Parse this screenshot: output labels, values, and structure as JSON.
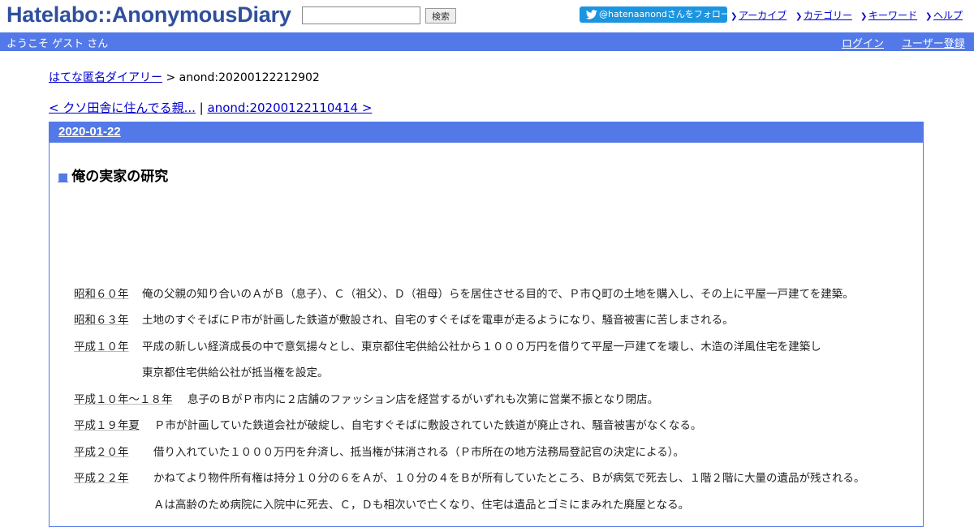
{
  "header": {
    "logo": "Hatelabo::AnonymousDiary",
    "search_value": "",
    "search_button": "検索",
    "twitter_follow": "@hatenaanondさんをフォロー",
    "links": [
      "アーカイブ",
      "カテゴリー",
      "キーワード",
      "ヘルプ"
    ]
  },
  "bluebar": {
    "welcome": "ようこそ ゲスト さん",
    "login": "ログイン",
    "register": "ユーザー登録"
  },
  "breadcrumb": {
    "home": "はてな匿名ダイアリー",
    "separator": " > ",
    "current": "anond:20200122212902"
  },
  "entry_nav": {
    "prev": "< クソ田舎に住んでる親...",
    "separator": " | ",
    "next": "anond:20200122110414 >"
  },
  "day": {
    "date": "2020-01-22",
    "title_marker": "■",
    "title": "俺の実家の研究"
  },
  "body_lines": [
    {
      "year": "昭和６０年",
      "text": "俺の父親の知り合いのＡがＢ（息子）、Ｃ（祖父）、Ｄ（祖母）らを居住させる目的で、Ｐ市Ｑ町の土地を購入し、その上に平屋一戸建てを建築。"
    },
    {
      "year": "昭和６３年",
      "text": "土地のすぐそばにＰ市が計画した鉄道が敷設され、自宅のすぐそばを電車が走るようになり、騒音被害に苦しまされる。"
    },
    {
      "year": "平成１０年",
      "text": "平成の新しい経済成長の中で意気揚々とし、東京都住宅供給公社から１０００万円を借りて平屋一戸建てを壊し、木造の洋風住宅を建築し"
    },
    {
      "year": "",
      "text": "東京都住宅供給公社が抵当権を設定。"
    },
    {
      "year": "平成１０年～１８年",
      "text": "息子のＢがＰ市内に２店舗のファッション店を経営するがいずれも次第に営業不振となり閉店。"
    },
    {
      "year": "平成１９年夏",
      "text": "Ｐ市が計画していた鉄道会社が破綻し、自宅すぐそばに敷設されていた鉄道が廃止され、騒音被害がなくなる。"
    },
    {
      "year": "平成２０年",
      "text": "借り入れていた１０００万円を弁済し、抵当権が抹消される（Ｐ市所在の地方法務局登記官の決定による）。"
    },
    {
      "year": "平成２２年",
      "text": "かねてより物件所有権は持分１０分の６をＡが、１０分の４をＢが所有していたところ、Ｂが病気で死去し、１階２階に大量の遺品が残される。"
    },
    {
      "year": "",
      "text": "Ａは高齢のため病院に入院中に死去、Ｃ，Ｄも相次いで亡くなり、住宅は遺品とゴミにまみれた廃屋となる。"
    }
  ]
}
